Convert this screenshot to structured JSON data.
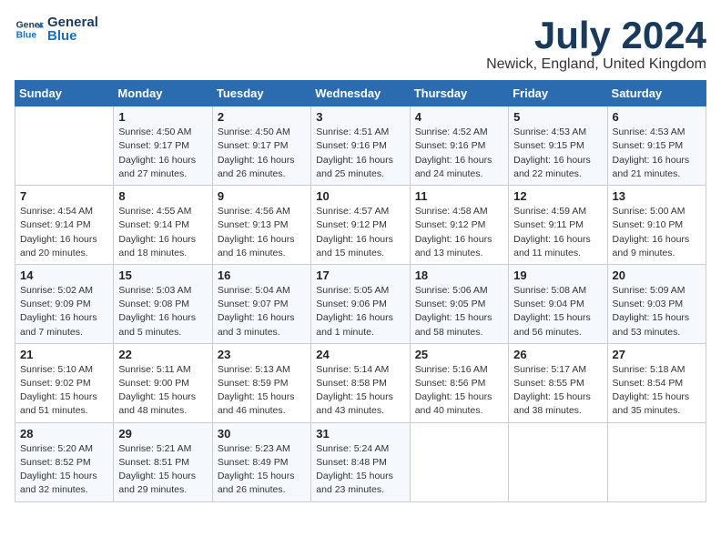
{
  "header": {
    "logo_line1": "General",
    "logo_line2": "Blue",
    "month_title": "July 2024",
    "location": "Newick, England, United Kingdom"
  },
  "days_of_week": [
    "Sunday",
    "Monday",
    "Tuesday",
    "Wednesday",
    "Thursday",
    "Friday",
    "Saturday"
  ],
  "weeks": [
    [
      {
        "day": "",
        "info": ""
      },
      {
        "day": "1",
        "info": "Sunrise: 4:50 AM\nSunset: 9:17 PM\nDaylight: 16 hours\nand 27 minutes."
      },
      {
        "day": "2",
        "info": "Sunrise: 4:50 AM\nSunset: 9:17 PM\nDaylight: 16 hours\nand 26 minutes."
      },
      {
        "day": "3",
        "info": "Sunrise: 4:51 AM\nSunset: 9:16 PM\nDaylight: 16 hours\nand 25 minutes."
      },
      {
        "day": "4",
        "info": "Sunrise: 4:52 AM\nSunset: 9:16 PM\nDaylight: 16 hours\nand 24 minutes."
      },
      {
        "day": "5",
        "info": "Sunrise: 4:53 AM\nSunset: 9:15 PM\nDaylight: 16 hours\nand 22 minutes."
      },
      {
        "day": "6",
        "info": "Sunrise: 4:53 AM\nSunset: 9:15 PM\nDaylight: 16 hours\nand 21 minutes."
      }
    ],
    [
      {
        "day": "7",
        "info": "Sunrise: 4:54 AM\nSunset: 9:14 PM\nDaylight: 16 hours\nand 20 minutes."
      },
      {
        "day": "8",
        "info": "Sunrise: 4:55 AM\nSunset: 9:14 PM\nDaylight: 16 hours\nand 18 minutes."
      },
      {
        "day": "9",
        "info": "Sunrise: 4:56 AM\nSunset: 9:13 PM\nDaylight: 16 hours\nand 16 minutes."
      },
      {
        "day": "10",
        "info": "Sunrise: 4:57 AM\nSunset: 9:12 PM\nDaylight: 16 hours\nand 15 minutes."
      },
      {
        "day": "11",
        "info": "Sunrise: 4:58 AM\nSunset: 9:12 PM\nDaylight: 16 hours\nand 13 minutes."
      },
      {
        "day": "12",
        "info": "Sunrise: 4:59 AM\nSunset: 9:11 PM\nDaylight: 16 hours\nand 11 minutes."
      },
      {
        "day": "13",
        "info": "Sunrise: 5:00 AM\nSunset: 9:10 PM\nDaylight: 16 hours\nand 9 minutes."
      }
    ],
    [
      {
        "day": "14",
        "info": "Sunrise: 5:02 AM\nSunset: 9:09 PM\nDaylight: 16 hours\nand 7 minutes."
      },
      {
        "day": "15",
        "info": "Sunrise: 5:03 AM\nSunset: 9:08 PM\nDaylight: 16 hours\nand 5 minutes."
      },
      {
        "day": "16",
        "info": "Sunrise: 5:04 AM\nSunset: 9:07 PM\nDaylight: 16 hours\nand 3 minutes."
      },
      {
        "day": "17",
        "info": "Sunrise: 5:05 AM\nSunset: 9:06 PM\nDaylight: 16 hours\nand 1 minute."
      },
      {
        "day": "18",
        "info": "Sunrise: 5:06 AM\nSunset: 9:05 PM\nDaylight: 15 hours\nand 58 minutes."
      },
      {
        "day": "19",
        "info": "Sunrise: 5:08 AM\nSunset: 9:04 PM\nDaylight: 15 hours\nand 56 minutes."
      },
      {
        "day": "20",
        "info": "Sunrise: 5:09 AM\nSunset: 9:03 PM\nDaylight: 15 hours\nand 53 minutes."
      }
    ],
    [
      {
        "day": "21",
        "info": "Sunrise: 5:10 AM\nSunset: 9:02 PM\nDaylight: 15 hours\nand 51 minutes."
      },
      {
        "day": "22",
        "info": "Sunrise: 5:11 AM\nSunset: 9:00 PM\nDaylight: 15 hours\nand 48 minutes."
      },
      {
        "day": "23",
        "info": "Sunrise: 5:13 AM\nSunset: 8:59 PM\nDaylight: 15 hours\nand 46 minutes."
      },
      {
        "day": "24",
        "info": "Sunrise: 5:14 AM\nSunset: 8:58 PM\nDaylight: 15 hours\nand 43 minutes."
      },
      {
        "day": "25",
        "info": "Sunrise: 5:16 AM\nSunset: 8:56 PM\nDaylight: 15 hours\nand 40 minutes."
      },
      {
        "day": "26",
        "info": "Sunrise: 5:17 AM\nSunset: 8:55 PM\nDaylight: 15 hours\nand 38 minutes."
      },
      {
        "day": "27",
        "info": "Sunrise: 5:18 AM\nSunset: 8:54 PM\nDaylight: 15 hours\nand 35 minutes."
      }
    ],
    [
      {
        "day": "28",
        "info": "Sunrise: 5:20 AM\nSunset: 8:52 PM\nDaylight: 15 hours\nand 32 minutes."
      },
      {
        "day": "29",
        "info": "Sunrise: 5:21 AM\nSunset: 8:51 PM\nDaylight: 15 hours\nand 29 minutes."
      },
      {
        "day": "30",
        "info": "Sunrise: 5:23 AM\nSunset: 8:49 PM\nDaylight: 15 hours\nand 26 minutes."
      },
      {
        "day": "31",
        "info": "Sunrise: 5:24 AM\nSunset: 8:48 PM\nDaylight: 15 hours\nand 23 minutes."
      },
      {
        "day": "",
        "info": ""
      },
      {
        "day": "",
        "info": ""
      },
      {
        "day": "",
        "info": ""
      }
    ]
  ]
}
